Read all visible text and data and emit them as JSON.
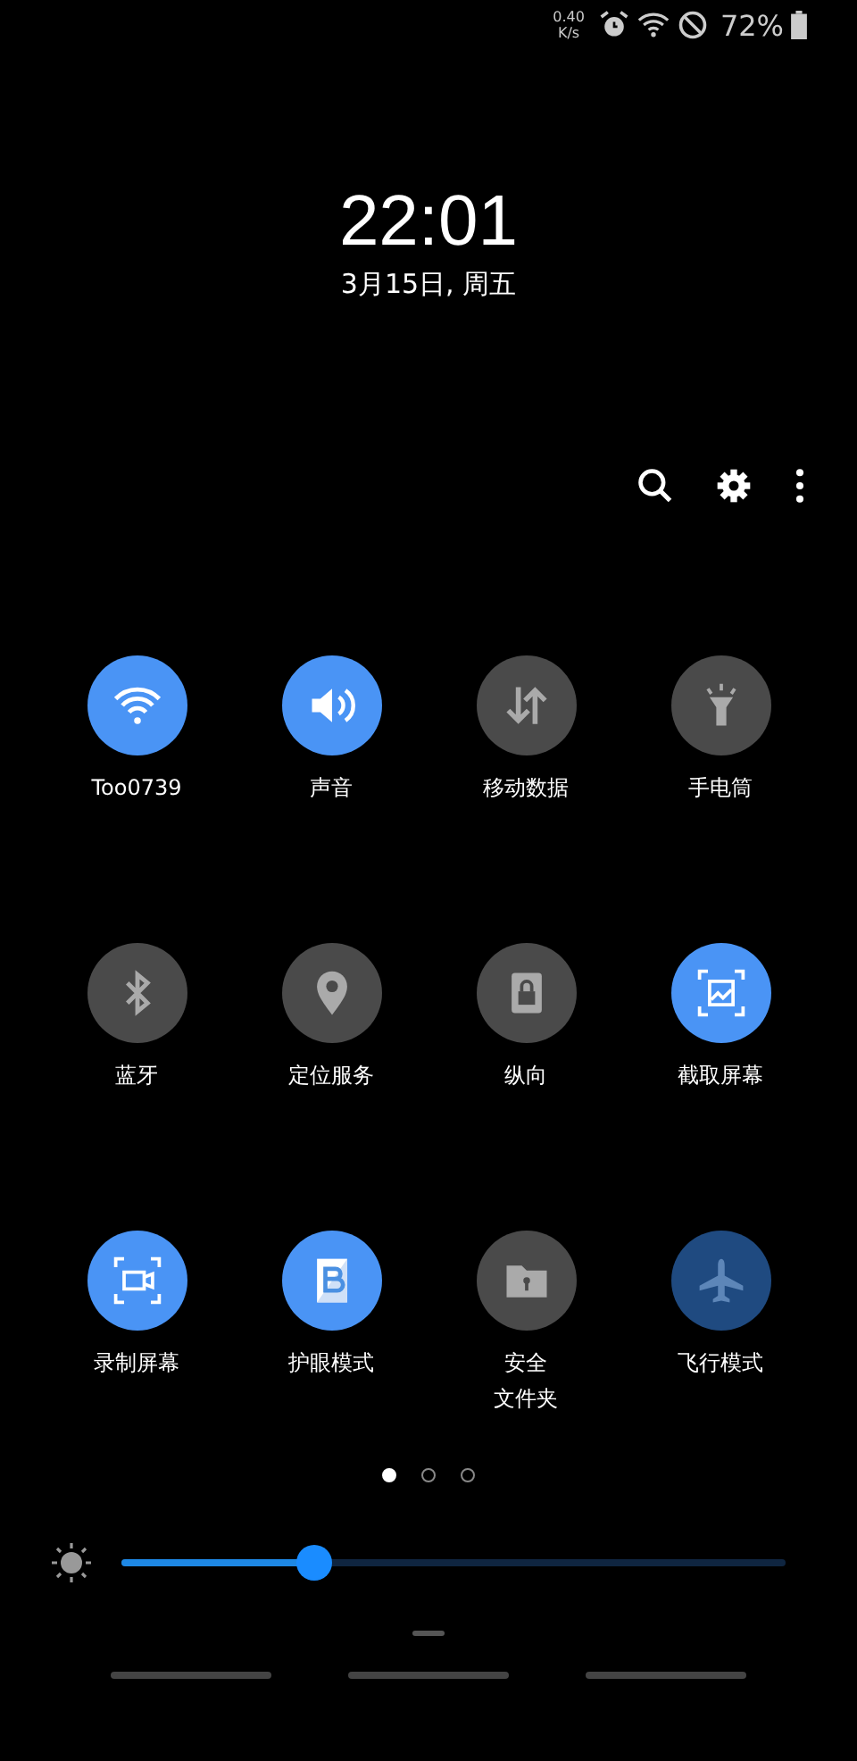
{
  "status_bar": {
    "speed": "0.40",
    "speed_unit": "K/s",
    "battery": "72%"
  },
  "clock": {
    "time": "22:01",
    "date": "3月15日, 周五"
  },
  "tiles": [
    {
      "kind": "wifi",
      "label": [
        "Too0739"
      ],
      "on": true,
      "disabled": false
    },
    {
      "kind": "sound",
      "label": [
        "声音"
      ],
      "on": true,
      "disabled": false
    },
    {
      "kind": "data",
      "label": [
        "移动数据"
      ],
      "on": false,
      "disabled": false
    },
    {
      "kind": "flashlight",
      "label": [
        "手电筒"
      ],
      "on": false,
      "disabled": false
    },
    {
      "kind": "bluetooth",
      "label": [
        "蓝牙"
      ],
      "on": false,
      "disabled": false
    },
    {
      "kind": "location",
      "label": [
        "定位服务"
      ],
      "on": false,
      "disabled": false
    },
    {
      "kind": "lock",
      "label": [
        "纵向"
      ],
      "on": false,
      "disabled": false
    },
    {
      "kind": "screenshot",
      "label": [
        "截取屏幕"
      ],
      "on": true,
      "disabled": false
    },
    {
      "kind": "record",
      "label": [
        "录制屏幕"
      ],
      "on": true,
      "disabled": false
    },
    {
      "kind": "eye",
      "label": [
        "护眼模式"
      ],
      "on": true,
      "disabled": false
    },
    {
      "kind": "folder",
      "label": [
        "安全",
        "文件夹"
      ],
      "on": false,
      "disabled": false
    },
    {
      "kind": "airplane",
      "label": [
        "飞行模式"
      ],
      "on": true,
      "disabled": true
    }
  ],
  "pages": [
    {
      "selected": true
    },
    {
      "selected": false
    },
    {
      "selected": false
    }
  ],
  "brightness": {
    "level": 0.29
  }
}
